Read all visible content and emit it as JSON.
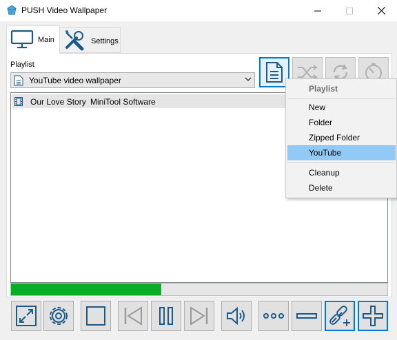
{
  "window": {
    "title": "PUSH Video Wallpaper"
  },
  "tabs": [
    {
      "label": "Main",
      "icon": "monitor-icon"
    },
    {
      "label": "Settings",
      "icon": "tools-icon"
    }
  ],
  "playlist": {
    "label": "Playlist",
    "selected": "YouTube video wallpaper"
  },
  "list": {
    "items": [
      {
        "title": "Our Love Story",
        "author": "MiniTool Software"
      }
    ]
  },
  "progress": {
    "percent": 40
  },
  "context_menu": {
    "header": "Playlist",
    "items": [
      "New",
      "Folder",
      "Zipped Folder",
      "YouTube",
      "Cleanup",
      "Delete"
    ],
    "highlighted": "YouTube"
  },
  "colors": {
    "accent": "#0078d7",
    "icon": "#1a5a8a",
    "progress": "#06b025",
    "highlight": "#91c9f7"
  }
}
